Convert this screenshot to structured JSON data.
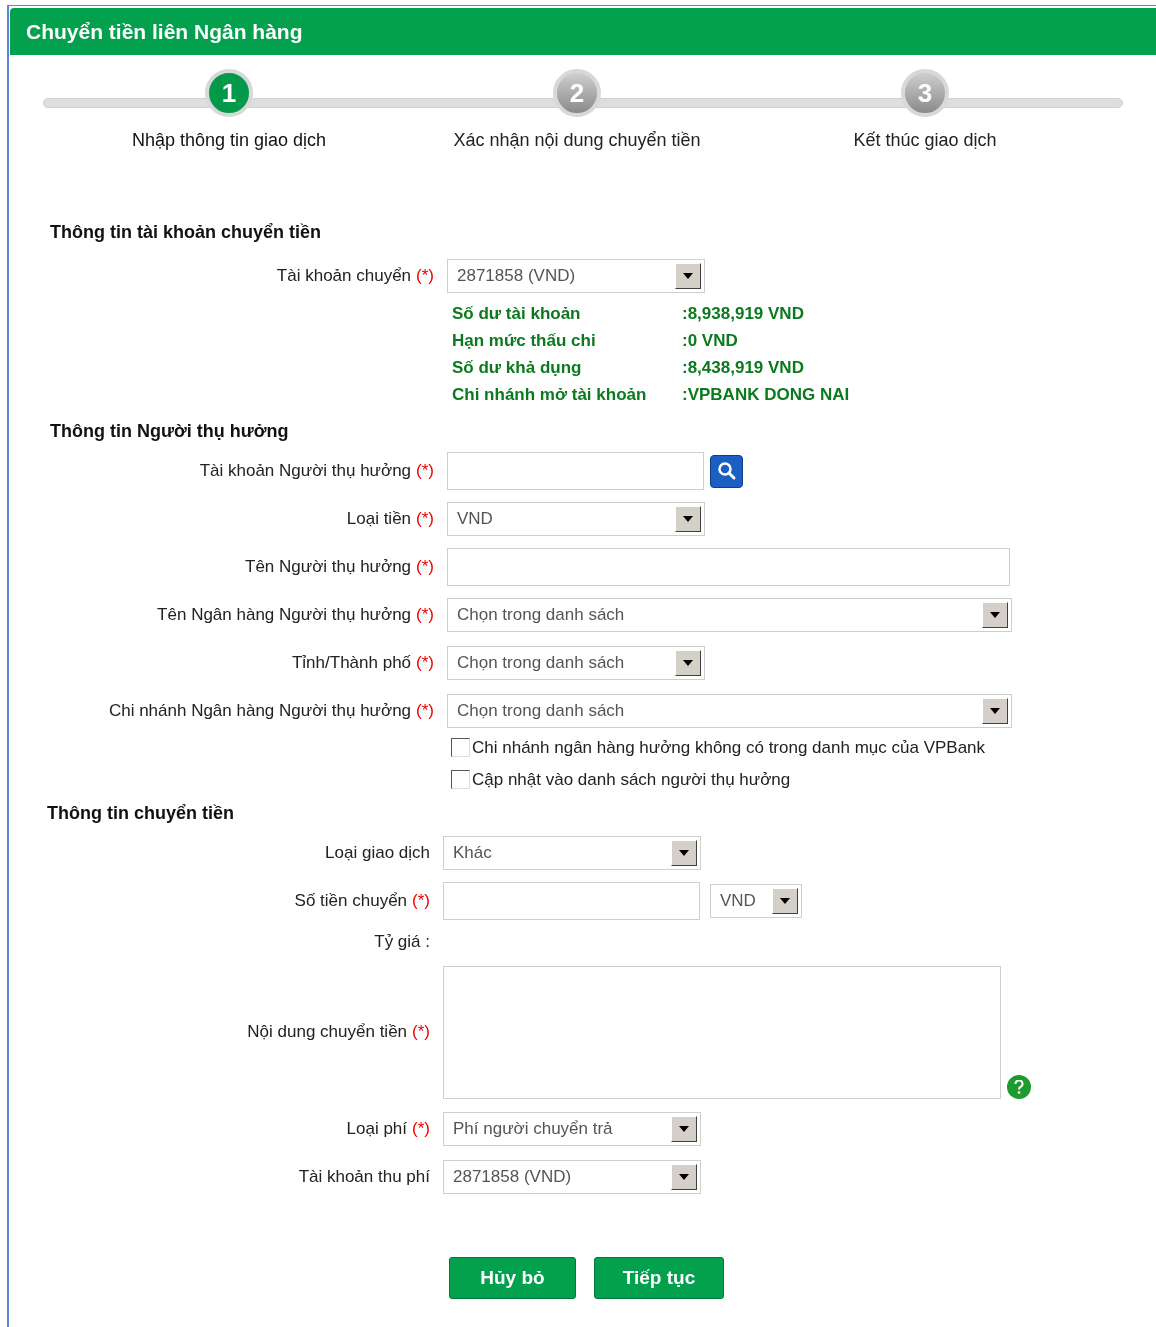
{
  "header": {
    "title": "Chuyển tiền liên Ngân hàng"
  },
  "steps": [
    {
      "number": "1",
      "label": "Nhập thông tin giao dịch",
      "selected": true
    },
    {
      "number": "2",
      "label": "Xác nhận nội dung chuyển tiền",
      "selected": false
    },
    {
      "number": "3",
      "label": "Kết thúc giao dịch",
      "selected": false
    }
  ],
  "sections": [
    {
      "title": "Thông tin tài khoản chuyển tiền",
      "rows": [
        {
          "kind": "select",
          "label": "Tài khoản chuyển",
          "marker": "(*)",
          "value": "2871858 (VND)"
        }
      ],
      "account_info": [
        {
          "label": "Số dư tài khoản",
          "value": ":8,938,919 VND"
        },
        {
          "label": "Hạn mức thấu chi",
          "value": ":0 VND"
        },
        {
          "label": "Số dư khả dụng",
          "value": ":8,438,919 VND"
        },
        {
          "label": "Chi nhánh mở tài khoản",
          "value": ":VPBANK DONG NAI"
        }
      ]
    },
    {
      "title": "Thông tin Người thụ hưởng",
      "rows": [
        {
          "kind": "lookup",
          "label": "Tài khoản Người thụ hưởng",
          "marker": "(*)"
        },
        {
          "kind": "select",
          "label": "Loại tiền",
          "marker": "(*)",
          "value": "VND"
        },
        {
          "kind": "widetext",
          "label": "Tên Người thụ hưởng",
          "marker": "(*)"
        },
        {
          "kind": "wideselect",
          "label": "Tên Ngân hàng Người thụ hưởng",
          "marker": "(*)",
          "value": "Chọn trong danh sách"
        },
        {
          "kind": "select",
          "label": "Tỉnh/Thành phố",
          "marker": "(*)",
          "value": "Chọn trong danh sách"
        },
        {
          "kind": "wideselect",
          "label": "Chi nhánh Ngân hàng Người thụ hưởng",
          "marker": "(*)",
          "value": "Chọn trong danh sách"
        }
      ],
      "checkboxes": [
        {
          "label": "Chi nhánh ngân hàng hưởng không có trong danh mục của VPBank",
          "checked": false
        },
        {
          "label": "Cập nhật vào danh sách người thụ hưởng",
          "checked": false
        }
      ]
    },
    {
      "title": "Thông tin chuyển tiền",
      "rows": [
        {
          "kind": "select",
          "label": "Loại giao dịch",
          "value": "Khác"
        },
        {
          "kind": "amount",
          "label": "Số tiền chuyển",
          "marker": "(*)",
          "currency": "VND"
        },
        {
          "kind": "note",
          "label": "Tỷ giá :"
        },
        {
          "kind": "textarea",
          "label": "Nội dung chuyển tiền",
          "marker": "(*)"
        },
        {
          "kind": "select",
          "label": "Loại phí",
          "marker": "(*)",
          "value": "Phí người chuyển trả"
        },
        {
          "kind": "select",
          "label": "Tài khoản thu phí",
          "value": "2871858 (VND)"
        }
      ]
    }
  ],
  "buttons": [
    "Hủy bỏ",
    "Tiếp tục"
  ]
}
